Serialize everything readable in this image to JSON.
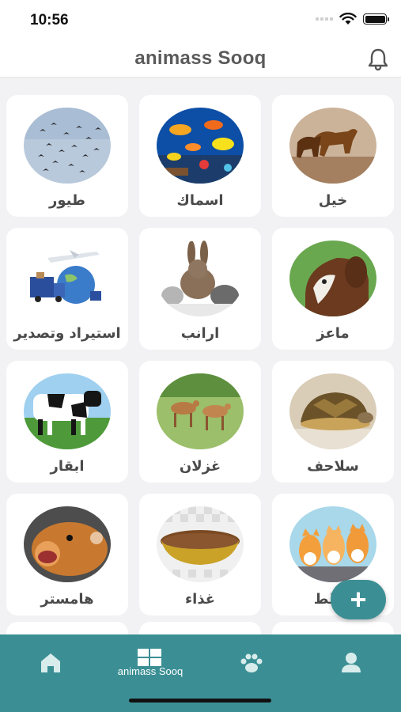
{
  "status_bar": {
    "time": "10:56"
  },
  "header": {
    "title": "animass Sooq",
    "bell_icon": "bell-icon"
  },
  "categories": [
    {
      "label": "خيل",
      "icon": "horses-photo"
    },
    {
      "label": "اسماك",
      "icon": "fish-photo"
    },
    {
      "label": "طيور",
      "icon": "birds-photo"
    },
    {
      "label": "ماعز",
      "icon": "goat-photo"
    },
    {
      "label": "ارانب",
      "icon": "rabbits-photo"
    },
    {
      "label": "استيراد وتصدير",
      "icon": "shipping-photo"
    },
    {
      "label": "سلاحف",
      "icon": "turtle-photo"
    },
    {
      "label": "غزلان",
      "icon": "deer-photo"
    },
    {
      "label": "ابقار",
      "icon": "cow-photo"
    },
    {
      "label": "قطط",
      "icon": "cats-photo"
    },
    {
      "label": "غذاء",
      "icon": "food-bowl-photo"
    },
    {
      "label": "هامستر",
      "icon": "hamster-photo"
    }
  ],
  "fab": {
    "label": "+"
  },
  "tabbar": {
    "active_label": "animass Sooq",
    "items": [
      "home-icon",
      "grid-icon",
      "paw-icon",
      "profile-icon"
    ]
  },
  "colors": {
    "accent": "#3b8f94",
    "background": "#f2f2f4",
    "card": "#ffffff"
  }
}
